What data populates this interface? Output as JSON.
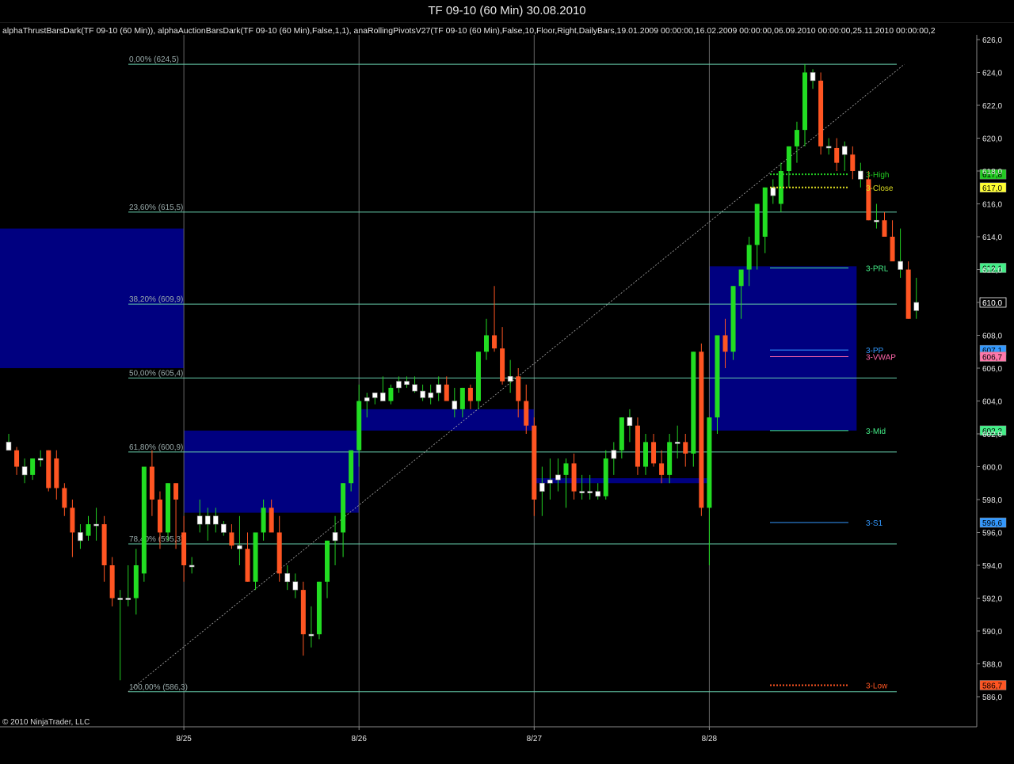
{
  "window": {
    "title": "TF 09-10 (60 Min)  30.08.2010"
  },
  "indicators_text": "alphaThrustBarsDark(TF 09-10 (60 Min)), alphaAuctionBarsDark(TF 09-10 (60 Min),False,1,1), anaRollingPivotsV27(TF 09-10 (60 Min),False,10,Floor,Right,DailyBars,19.01.2009 00:00:00,16.02.2009 00:00:00,06.09.2010 00:00:00,25.11.2010 00:00:00,2",
  "copyright": "© 2010 NinjaTrader, LLC",
  "colors": {
    "up": "#22dd22",
    "down": "#ff5522",
    "doji": "#ffffff",
    "grid": "#666666",
    "block": "#000080",
    "fib": "#66ccaa",
    "magenta": "#cc33cc",
    "trend": "#aaaaaa"
  },
  "chart_data": {
    "type": "candlestick",
    "ylim": [
      585,
      626.5
    ],
    "yticks": [
      586,
      588,
      590,
      592,
      594,
      596,
      598,
      600,
      602,
      604,
      606,
      608,
      610,
      612,
      614,
      616,
      618,
      620,
      622,
      624,
      626
    ],
    "ytick_labels": [
      "586,0",
      "588,0",
      "590,0",
      "592,0",
      "594,0",
      "596,0",
      "598,0",
      "600,0",
      "602,0",
      "604,0",
      "606,0",
      "608,0",
      "610,0",
      "612,0",
      "614,0",
      "616,0",
      "618,0",
      "620,0",
      "622,0",
      "624,0",
      "626,0"
    ],
    "x_labels": [
      {
        "label": "8/25",
        "bar": 22
      },
      {
        "label": "8/26",
        "bar": 44
      },
      {
        "label": "8/27",
        "bar": 66
      },
      {
        "label": "8/28",
        "bar": 88
      }
    ],
    "bar_count": 108,
    "candles": [
      [
        601.5,
        602,
        601,
        601
      ],
      [
        601,
        601.2,
        599.5,
        600
      ],
      [
        600,
        600.5,
        599,
        599.5
      ],
      [
        599.5,
        600.5,
        599.2,
        600.5
      ],
      [
        600.5,
        601,
        600,
        600.5
      ],
      [
        601,
        601,
        598.5,
        598.7
      ],
      [
        600.5,
        601,
        598,
        598.7
      ],
      [
        598.7,
        599,
        597,
        597.5
      ],
      [
        597.5,
        598,
        594.5,
        596
      ],
      [
        596,
        596.5,
        595,
        595.5
      ],
      [
        595.8,
        597,
        595.5,
        596.5
      ],
      [
        596.5,
        597.5,
        595.5,
        596.5
      ],
      [
        596.5,
        597,
        593,
        594
      ],
      [
        594,
        594.5,
        591.5,
        592
      ],
      [
        592,
        592.5,
        587,
        592
      ],
      [
        592,
        594,
        591.5,
        592
      ],
      [
        592,
        595,
        591,
        594
      ],
      [
        593.5,
        600,
        593,
        600
      ],
      [
        600,
        601,
        597,
        598
      ],
      [
        598,
        598.5,
        595,
        596
      ],
      [
        596,
        599,
        595.5,
        599
      ],
      [
        599,
        599,
        595,
        598
      ],
      [
        596,
        597,
        593,
        594
      ],
      [
        594,
        594.5,
        593.5,
        594
      ],
      [
        597,
        598,
        596,
        596.5
      ],
      [
        596.5,
        597.5,
        595.5,
        597
      ],
      [
        597,
        597.5,
        596,
        596.5
      ],
      [
        596.5,
        596.7,
        595.8,
        596
      ],
      [
        596,
        596.5,
        595,
        595.2
      ],
      [
        595.2,
        597,
        594,
        595
      ],
      [
        595,
        596,
        593,
        593
      ],
      [
        593,
        596,
        592.5,
        596
      ],
      [
        596,
        598,
        595.5,
        597.5
      ],
      [
        597.5,
        598,
        596,
        596
      ],
      [
        596,
        597,
        593,
        593.5
      ],
      [
        593.5,
        594,
        592.5,
        593
      ],
      [
        593,
        593.5,
        592,
        592.5
      ],
      [
        592.5,
        593,
        588.5,
        589.8
      ],
      [
        589.8,
        591.5,
        589,
        589.8
      ],
      [
        589.8,
        593,
        589.5,
        593
      ],
      [
        593,
        595.5,
        592,
        595.5
      ],
      [
        595.5,
        597,
        594,
        596
      ],
      [
        596,
        599,
        594.5,
        599
      ],
      [
        599,
        601,
        598.5,
        601
      ],
      [
        601,
        605,
        600,
        604
      ],
      [
        604,
        604.5,
        603,
        604.2
      ],
      [
        604.2,
        604.5,
        603.8,
        604.5
      ],
      [
        604.5,
        605.5,
        604,
        604
      ],
      [
        604,
        605,
        603.8,
        604.8
      ],
      [
        604.8,
        605.5,
        604.5,
        605.2
      ],
      [
        605.2,
        605.5,
        604.8,
        605
      ],
      [
        605,
        605.5,
        604.5,
        604.6
      ],
      [
        604.6,
        605,
        604,
        604.2
      ],
      [
        604.2,
        605,
        603.8,
        604.5
      ],
      [
        604.5,
        605.5,
        604,
        605
      ],
      [
        605,
        605.5,
        604,
        604
      ],
      [
        604,
        604.8,
        603,
        603.5
      ],
      [
        603.5,
        604.8,
        603,
        604.8
      ],
      [
        604.8,
        605,
        603.5,
        604
      ],
      [
        604,
        607,
        603.5,
        607
      ],
      [
        607,
        609,
        606.5,
        608
      ],
      [
        608,
        611,
        607,
        607.2
      ],
      [
        607.2,
        608.5,
        605,
        605.2
      ],
      [
        605.2,
        606.5,
        604.5,
        605.5
      ],
      [
        605.5,
        606,
        603,
        604
      ],
      [
        604,
        605,
        602,
        602.5
      ],
      [
        602.5,
        603,
        597,
        598
      ],
      [
        598.5,
        600,
        597,
        599
      ],
      [
        599,
        600.5,
        598,
        599.2
      ],
      [
        599.2,
        600.5,
        598.5,
        599.5
      ],
      [
        599.5,
        600.5,
        597.5,
        600.2
      ],
      [
        600.2,
        600.8,
        598,
        598.5
      ],
      [
        598.5,
        599.5,
        598,
        598.5
      ],
      [
        598.5,
        599.5,
        598,
        598.5
      ],
      [
        598.5,
        599,
        598,
        598.2
      ],
      [
        598.2,
        601,
        598,
        600.5
      ],
      [
        600.5,
        601.5,
        599.5,
        601
      ],
      [
        601,
        603,
        600.5,
        603
      ],
      [
        603,
        603.5,
        601.5,
        602.5
      ],
      [
        602.5,
        603,
        599.5,
        600
      ],
      [
        600,
        602,
        599.5,
        601.5
      ],
      [
        601.5,
        602,
        600,
        600.2
      ],
      [
        600.2,
        601,
        599,
        599.5
      ],
      [
        599.5,
        602,
        599,
        601.5
      ],
      [
        601.5,
        602.5,
        600.5,
        601.5
      ],
      [
        601.5,
        602,
        600,
        600.8
      ],
      [
        600.8,
        607,
        600,
        607
      ],
      [
        607,
        607.5,
        597,
        597.5
      ],
      [
        597.5,
        603,
        594,
        603
      ],
      [
        603,
        608,
        602,
        608
      ],
      [
        608,
        609,
        606,
        607
      ],
      [
        607,
        611,
        606.5,
        611
      ],
      [
        611,
        612,
        609,
        612
      ],
      [
        612,
        614,
        611,
        613.5
      ],
      [
        613.5,
        615,
        612,
        616
      ],
      [
        614,
        617,
        613,
        617
      ],
      [
        617,
        617.5,
        616,
        616.5
      ],
      [
        616,
        618.5,
        615.5,
        618
      ],
      [
        618,
        619.5,
        617,
        619.5
      ],
      [
        619.5,
        621,
        618.5,
        620.5
      ],
      [
        620.5,
        624.5,
        619.5,
        624
      ],
      [
        624,
        624.2,
        623,
        623.5
      ],
      [
        623.5,
        624,
        619,
        619.5
      ],
      [
        619.5,
        620,
        619,
        619.4
      ],
      [
        619.4,
        620,
        618,
        618.5
      ]
    ],
    "candles_tail": [
      [
        619.5,
        619.8,
        618,
        619
      ],
      [
        619,
        619.5,
        617.5,
        618
      ],
      [
        618,
        618.5,
        617,
        617.5
      ],
      [
        617.5,
        618,
        615,
        615
      ],
      [
        615,
        616,
        614.5,
        615
      ],
      [
        615,
        615.5,
        614,
        614
      ],
      [
        614,
        615,
        613,
        612.5
      ],
      [
        612.5,
        614.5,
        611.5,
        612
      ],
      [
        612,
        612.5,
        609,
        609
      ],
      [
        609.5,
        611.5,
        609,
        610
      ]
    ],
    "fib_levels": [
      {
        "label": "0,00% (624,5)",
        "value": 624.5
      },
      {
        "label": "23,60% (615,5)",
        "value": 615.5
      },
      {
        "label": "38,20% (609,9)",
        "value": 609.9
      },
      {
        "label": "50,00% (605,4)",
        "value": 605.4
      },
      {
        "label": "61,80% (600,9)",
        "value": 600.9
      },
      {
        "label": "78,40% (595,3)",
        "value": 595.3
      },
      {
        "label": "100,00% (586,3)",
        "value": 586.3
      }
    ],
    "pivots": [
      {
        "label": "3-High",
        "value": 617.8,
        "tag": "617,8",
        "color": "#22cc22",
        "tagcolor": "#22cc22",
        "dotted": true
      },
      {
        "label": "3-Close",
        "value": 617.0,
        "tag": "617,0",
        "color": "#dddd22",
        "tagcolor": "#ffff33",
        "dotted": true
      },
      {
        "label": "3-PRL",
        "value": 612.1,
        "tag": "612,1",
        "color": "#44ee88",
        "tagcolor": "#44ee88",
        "dotted": false
      },
      {
        "label": "3-PP",
        "value": 607.1,
        "tag": "607,1",
        "color": "#3399ff",
        "tagcolor": "#3399ff",
        "dotted": false
      },
      {
        "label": "3-VWAP",
        "value": 606.7,
        "tag": "606,7",
        "color": "#ff66aa",
        "tagcolor": "#ff77aa",
        "dotted": false
      },
      {
        "label": "3-Mid",
        "value": 602.2,
        "tag": "602,2",
        "color": "#44ee88",
        "tagcolor": "#44ee88",
        "dotted": false
      },
      {
        "label": "3-S1",
        "value": 596.6,
        "tag": "596,6",
        "color": "#3399ff",
        "tagcolor": "#3399ff",
        "dotted": false
      },
      {
        "label": "3-Low",
        "value": 586.7,
        "tag": "586,7",
        "color": "#ff5522",
        "tagcolor": "#ff5522",
        "dotted": true
      }
    ],
    "price_tag_last": {
      "value": 610.0,
      "tag": "610,0"
    },
    "blocks": [
      {
        "x0bar": -1,
        "x1bar": 22,
        "y0": 606,
        "y1": 614.5
      },
      {
        "x0bar": 22,
        "x1bar": 44,
        "y0": 597.2,
        "y1": 602.2
      },
      {
        "x0bar": 44,
        "x1bar": 66,
        "y0": 602.2,
        "y1": 603.5
      },
      {
        "x0bar": 66,
        "x1bar": 88,
        "y0": 599,
        "y1": 599.3
      },
      {
        "x0bar": 88,
        "x1bar": 106.5,
        "y0": 602.2,
        "y1": 612.2
      }
    ],
    "trendline": {
      "bar0": 15,
      "y0": 586.3,
      "bar1": 112.5,
      "y1": 624.5
    }
  }
}
